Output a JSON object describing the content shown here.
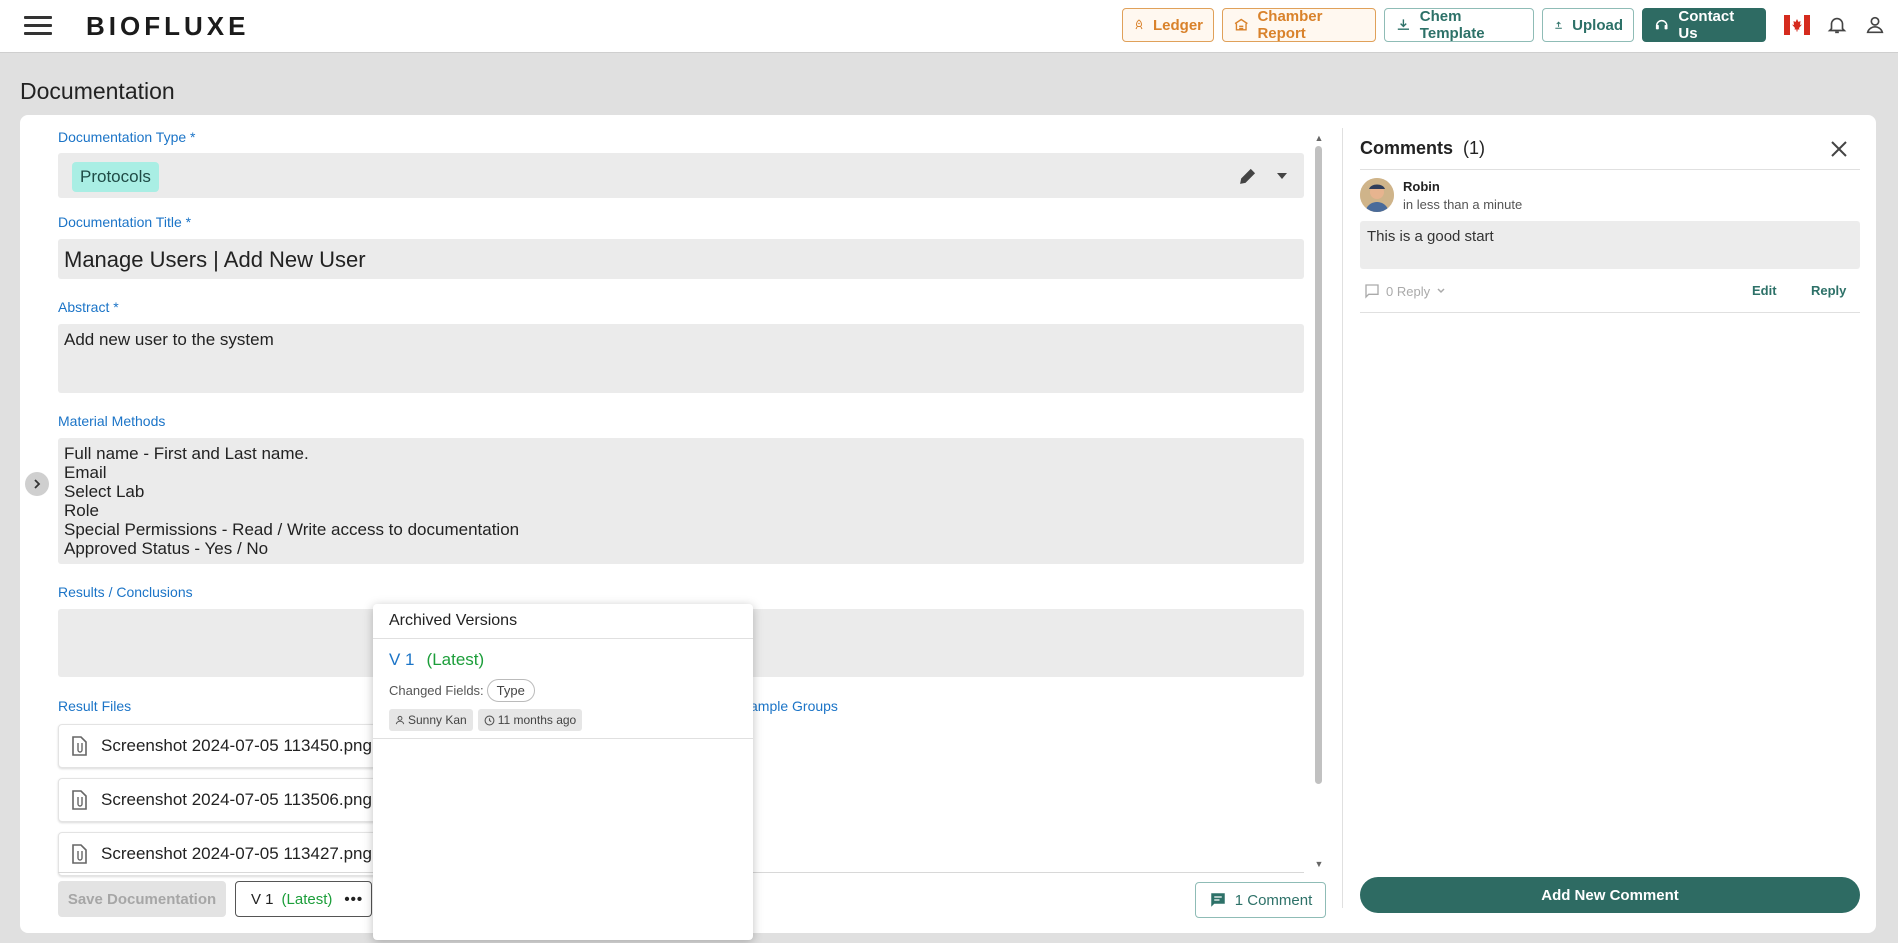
{
  "app": {
    "logo": "BIOFLUXE"
  },
  "toolbar": {
    "ledger": "Ledger",
    "chamber_report": "Chamber Report",
    "chem_template": "Chem Template",
    "upload": "Upload",
    "contact_us": "Contact Us"
  },
  "page": {
    "title": "Documentation"
  },
  "form": {
    "type_label": "Documentation Type *",
    "type_value": "Protocols",
    "title_label": "Documentation Title *",
    "title_value": "Manage Users | Add New User",
    "abstract_label": "Abstract *",
    "abstract_value": "Add new user to the system",
    "methods_label": "Material Methods",
    "methods_lines": [
      "Full name - First and Last name.",
      "Email",
      "Select Lab",
      "Role",
      "Special Permissions - Read / Write access to documentation",
      "Approved Status - Yes / No"
    ],
    "results_label": "Results / Conclusions",
    "result_files_label": "Result Files",
    "sample_groups_label": "ample Groups",
    "files": [
      "Screenshot 2024-07-05 113450.png",
      "Screenshot 2024-07-05 113506.png",
      "Screenshot 2024-07-05 113427.png"
    ]
  },
  "footer": {
    "save": "Save Documentation",
    "version": "V 1",
    "version_latest": "(Latest)",
    "comment_button": "1 Comment"
  },
  "archived": {
    "title": "Archived Versions",
    "version": "V 1",
    "latest": "(Latest)",
    "changed_fields_label": "Changed Fields:",
    "changed_field": "Type",
    "author": "Sunny Kan",
    "time": "11 months ago"
  },
  "comments": {
    "title": "Comments",
    "count": "(1)",
    "author": "Robin",
    "time": "in less than a minute",
    "body": "This is a good start",
    "reply_count": "0 Reply",
    "edit": "Edit",
    "reply": "Reply",
    "add": "Add New Comment"
  },
  "colors": {
    "brand": "#2e6b63",
    "accent_orange": "#d9822b",
    "link": "#1b74c7",
    "latest_green": "#1c9e3a"
  }
}
